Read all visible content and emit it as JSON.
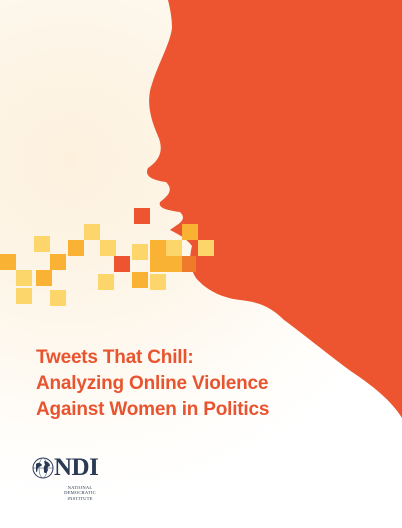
{
  "cover": {
    "title_lines": [
      "Tweets That Chill:",
      "Analyzing Online Violence",
      "Against Women in Politics"
    ],
    "colors": {
      "accent": "#e8542f",
      "pixel_gold": "#f9b233",
      "pixel_yellow": "#fdd66b",
      "pixel_orange": "#f07a2c",
      "logo_navy": "#2a3a55"
    }
  },
  "logo": {
    "name": "NDI",
    "subtitle_lines": [
      "NATIONAL",
      "DEMOCRATIC",
      "INSTITUTE"
    ],
    "icon": "globe-icon"
  }
}
